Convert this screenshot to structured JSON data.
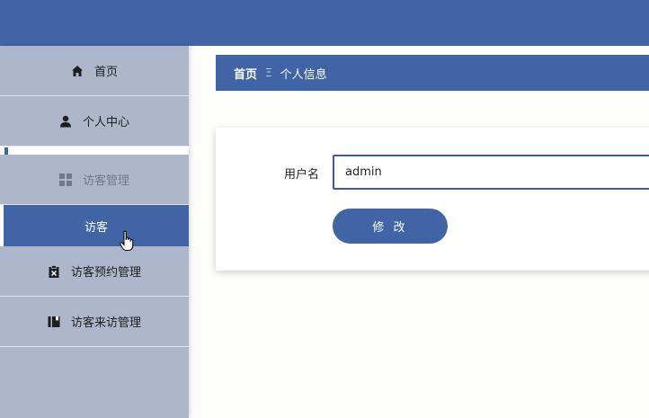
{
  "sidebar": {
    "items": [
      {
        "label": "首页",
        "icon": "home-icon"
      },
      {
        "label": "个人中心",
        "icon": "user-icon"
      },
      {
        "label": "访客管理",
        "icon": "grid-icon"
      },
      {
        "label": "访客",
        "icon": ""
      },
      {
        "label": "访客预约管理",
        "icon": "clipboard-x-icon"
      },
      {
        "label": "访客来访管理",
        "icon": "book-icon"
      }
    ]
  },
  "breadcrumb": {
    "home": "首页",
    "separator": "Ξ",
    "current": "个人信息"
  },
  "form": {
    "username_label": "用户名",
    "username_value": "admin",
    "submit_label": "修 改"
  },
  "colors": {
    "primary": "#4064a6",
    "sidebar_bg": "#adb6cb",
    "page_bg": "#fdfdfc"
  }
}
